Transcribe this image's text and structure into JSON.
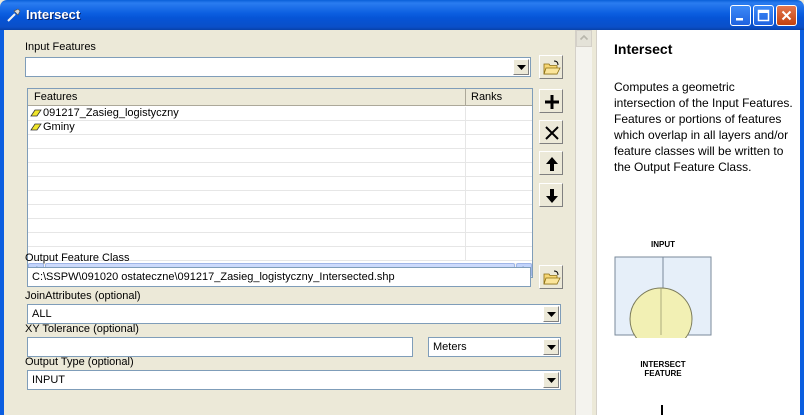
{
  "window": {
    "title": "Intersect"
  },
  "form": {
    "input_features_label": "Input Features",
    "input_features_value": "",
    "table": {
      "columns": [
        "Features",
        "Ranks"
      ],
      "rows": [
        {
          "feature": "091217_Zasieg_logistyczny",
          "rank": ""
        },
        {
          "feature": "Gminy",
          "rank": ""
        }
      ]
    },
    "output_label": "Output Feature Class",
    "output_value": "C:\\SSPW\\091020 ostateczne\\091217_Zasieg_logistyczny_Intersected.shp",
    "join_label": "JoinAttributes (optional)",
    "join_value": "ALL",
    "xy_label": "XY Tolerance (optional)",
    "xy_value": "",
    "xy_unit": "Meters",
    "output_type_label": "Output Type (optional)",
    "output_type_value": "INPUT"
  },
  "help": {
    "title": "Intersect",
    "text": "Computes a geometric intersection of the Input Features. Features or portions of features which overlap in all layers and/or feature classes will be written to the Output Feature Class.",
    "diagram_input_label": "INPUT",
    "diagram_intersect_label_1": "INTERSECT",
    "diagram_intersect_label_2": "FEATURE"
  },
  "colors": {
    "titlebar": "#0b5ee0",
    "dialog_bg": "#ece9d8",
    "field_border": "#7f9db9"
  }
}
